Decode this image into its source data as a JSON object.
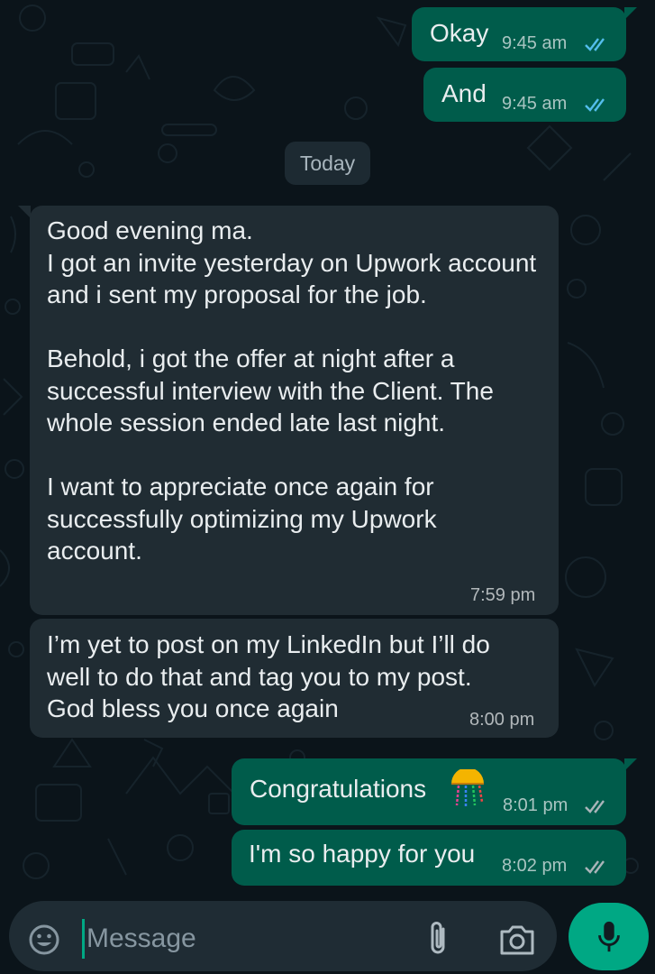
{
  "chat": {
    "date_divider": "Today",
    "messages": [
      {
        "direction": "outgoing",
        "text": "Okay",
        "time": "9:45 am",
        "status": "read"
      },
      {
        "direction": "outgoing",
        "text": "And",
        "time": "9:45 am",
        "status": "read"
      },
      {
        "direction": "incoming",
        "text": "Good evening ma.\nI got an invite yesterday on Upwork account and i sent my proposal for the job.\n\nBehold, i got the offer at night after a successful interview with the Client. The whole session ended late last night.\n\nI want to appreciate once again for successfully optimizing my Upwork account.",
        "time": "7:59 pm"
      },
      {
        "direction": "incoming",
        "text": "I’m yet to post on my LinkedIn but I’ll do well to do that and tag you to my post.\nGod bless you once again",
        "time": "8:00 pm"
      },
      {
        "direction": "outgoing",
        "text": "Congratulations",
        "time": "8:01 pm",
        "status": "read",
        "emoji": "confetti-ball"
      },
      {
        "direction": "outgoing",
        "text": "I'm so happy for you",
        "time": "8:02 pm",
        "status": "read"
      }
    ]
  },
  "composer": {
    "placeholder": "Message",
    "icons": [
      "emoji-icon",
      "attachment-icon",
      "camera-icon",
      "microphone-icon"
    ]
  },
  "colors": {
    "background": "#0b141a",
    "outgoing_bubble": "#005c4b",
    "incoming_bubble": "#202c33",
    "accent": "#00a884",
    "read_ticks": "#53bdeb"
  }
}
